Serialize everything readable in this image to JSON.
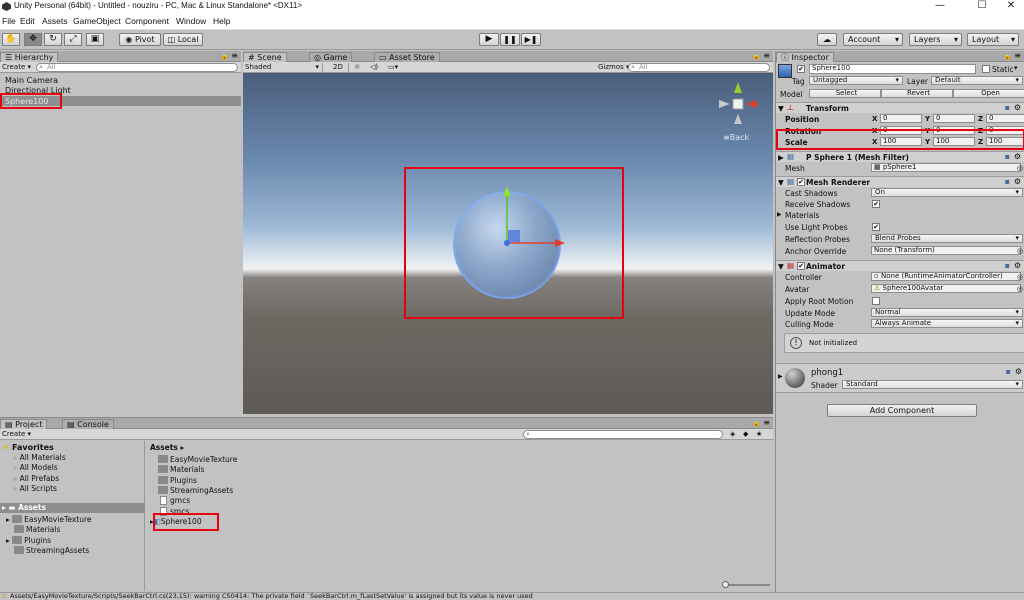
{
  "window": {
    "title": "Unity Personal (64bit) - Untitled - nouziru - PC, Mac & Linux Standalone* <DX11>",
    "minimize_glyph": "—",
    "maximize_glyph": "☐",
    "close_glyph": "✕"
  },
  "menu": [
    "File",
    "Edit",
    "Assets",
    "GameObject",
    "Component",
    "Window",
    "Help"
  ],
  "toolbar": {
    "pivot_label": "Pivot",
    "local_label": "Local",
    "account_label": "Account",
    "layers_label": "Layers",
    "layout_label": "Layout"
  },
  "hierarchy": {
    "tab": "Hierarchy",
    "create_label": "Create",
    "search_placeholder": "All",
    "items": [
      "Main Camera",
      "Directional Light",
      "Sphere100"
    ]
  },
  "scene": {
    "tabs": [
      "Scene",
      "Game",
      "Asset Store"
    ],
    "shading_mode": "Shaded",
    "mode_2d": "2D",
    "gizmos_label": "Gizmos",
    "search_placeholder": "All",
    "back_label": "Back"
  },
  "inspector": {
    "tab": "Inspector",
    "object_name": "Sphere100",
    "static_label": "Static",
    "tag_label": "Tag",
    "tag_value": "Untagged",
    "layer_label": "Layer",
    "layer_value": "Default",
    "model_label": "Model",
    "model_buttons": [
      "Select",
      "Revert",
      "Open"
    ],
    "transform": {
      "title": "Transform",
      "position_label": "Position",
      "rotation_label": "Rotation",
      "scale_label": "Scale",
      "position": [
        "0",
        "0",
        "0"
      ],
      "rotation": [
        "0",
        "0",
        "0"
      ],
      "scale": [
        "100",
        "100",
        "100"
      ]
    },
    "mesh_filter": {
      "title": "P Sphere 1 (Mesh Filter)",
      "mesh_label": "Mesh",
      "mesh_value": "pSphere1"
    },
    "mesh_renderer": {
      "title": "Mesh Renderer",
      "cast_shadows_label": "Cast Shadows",
      "cast_shadows_value": "On",
      "receive_shadows_label": "Receive Shadows",
      "materials_label": "Materials",
      "use_light_probes_label": "Use Light Probes",
      "reflection_probes_label": "Reflection Probes",
      "reflection_probes_value": "Blend Probes",
      "anchor_override_label": "Anchor Override",
      "anchor_override_value": "None (Transform)"
    },
    "animator": {
      "title": "Animator",
      "controller_label": "Controller",
      "controller_value": "None (RuntimeAnimatorController)",
      "avatar_label": "Avatar",
      "avatar_value": "Sphere100Avatar",
      "apply_root_motion_label": "Apply Root Motion",
      "update_mode_label": "Update Mode",
      "update_mode_value": "Normal",
      "culling_mode_label": "Culling Mode",
      "culling_mode_value": "Always Animate",
      "not_initialized": "Not initialized"
    },
    "material": {
      "name": "phong1",
      "shader_label": "Shader",
      "shader_value": "Standard"
    },
    "add_component_label": "Add Component"
  },
  "project": {
    "tabs": [
      "Project",
      "Console"
    ],
    "create_label": "Create",
    "favorites_label": "Favorites",
    "favorites": [
      "All Materials",
      "All Models",
      "All Prefabs",
      "All Scripts"
    ],
    "assets_label": "Assets",
    "tree": [
      "EasyMovieTexture",
      "Materials",
      "Plugins",
      "StreamingAssets"
    ],
    "breadcrumb": "Assets",
    "items": [
      "EasyMovieTexture",
      "Materials",
      "Plugins",
      "StreamingAssets",
      "gmcs",
      "smcs",
      "Sphere100"
    ]
  },
  "status_bar": {
    "message": "Assets/EasyMovieTexture/Scripts/SeekBarCtrl.cs(23,15): warning CS0414: The private field `SeekBarCtrl.m_fLastSetValue' is assigned but its value is never used"
  },
  "colors": {
    "highlight_red": "#e60012",
    "panel_bg": "#c2c2c2",
    "selection": "#8f8f8f"
  }
}
